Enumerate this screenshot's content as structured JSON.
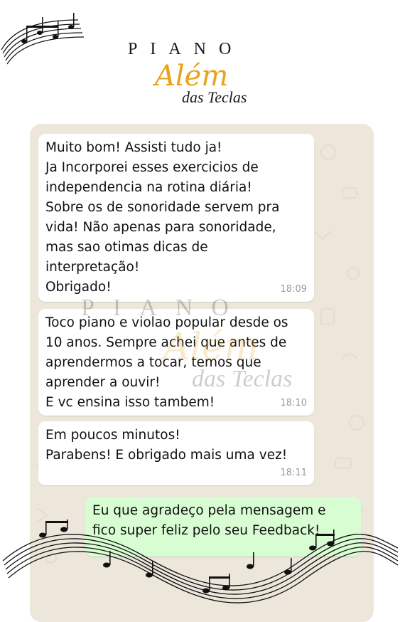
{
  "logo": {
    "line1": "PIANO",
    "line2": "Além",
    "line3": "das Teclas"
  },
  "messages": [
    {
      "direction": "incoming",
      "text": "Muito bom! Assisti tudo ja!\nJa Incorporei esses exercicios de\nindependencia na rotina diária!\nSobre os de sonoridade servem pra\nvida! Não apenas para sonoridade,\nmas sao otimas dicas de\ninterpretação!\nObrigado!",
      "time": "18:09"
    },
    {
      "direction": "incoming",
      "text": "Toco piano e violao popular desde os\n10 anos. Sempre achei que antes de\naprendermos a tocar, temos que\naprender a ouvir!\nE vc ensina isso tambem!",
      "time": "18:10"
    },
    {
      "direction": "incoming",
      "text": "Em poucos minutos!\nParabens! E obrigado mais uma vez!",
      "time": "18:11"
    },
    {
      "direction": "outgoing",
      "text": "Eu que agradeço pela mensagem e\nfico super feliz pelo seu Feedback!",
      "time": ""
    }
  ],
  "watermark": {
    "line1": "PIANO",
    "line2": "Além",
    "line3": "das Teclas"
  },
  "colors": {
    "chat_background": "#ece6db",
    "incoming_bubble": "#ffffff",
    "outgoing_bubble": "#d9fdd3",
    "logo_gold": "#e8a21c",
    "timestamp": "#9a9a9a"
  },
  "decorations": {
    "top_left": "music-staff-icon",
    "bottom": "music-staff-wave-icon"
  }
}
